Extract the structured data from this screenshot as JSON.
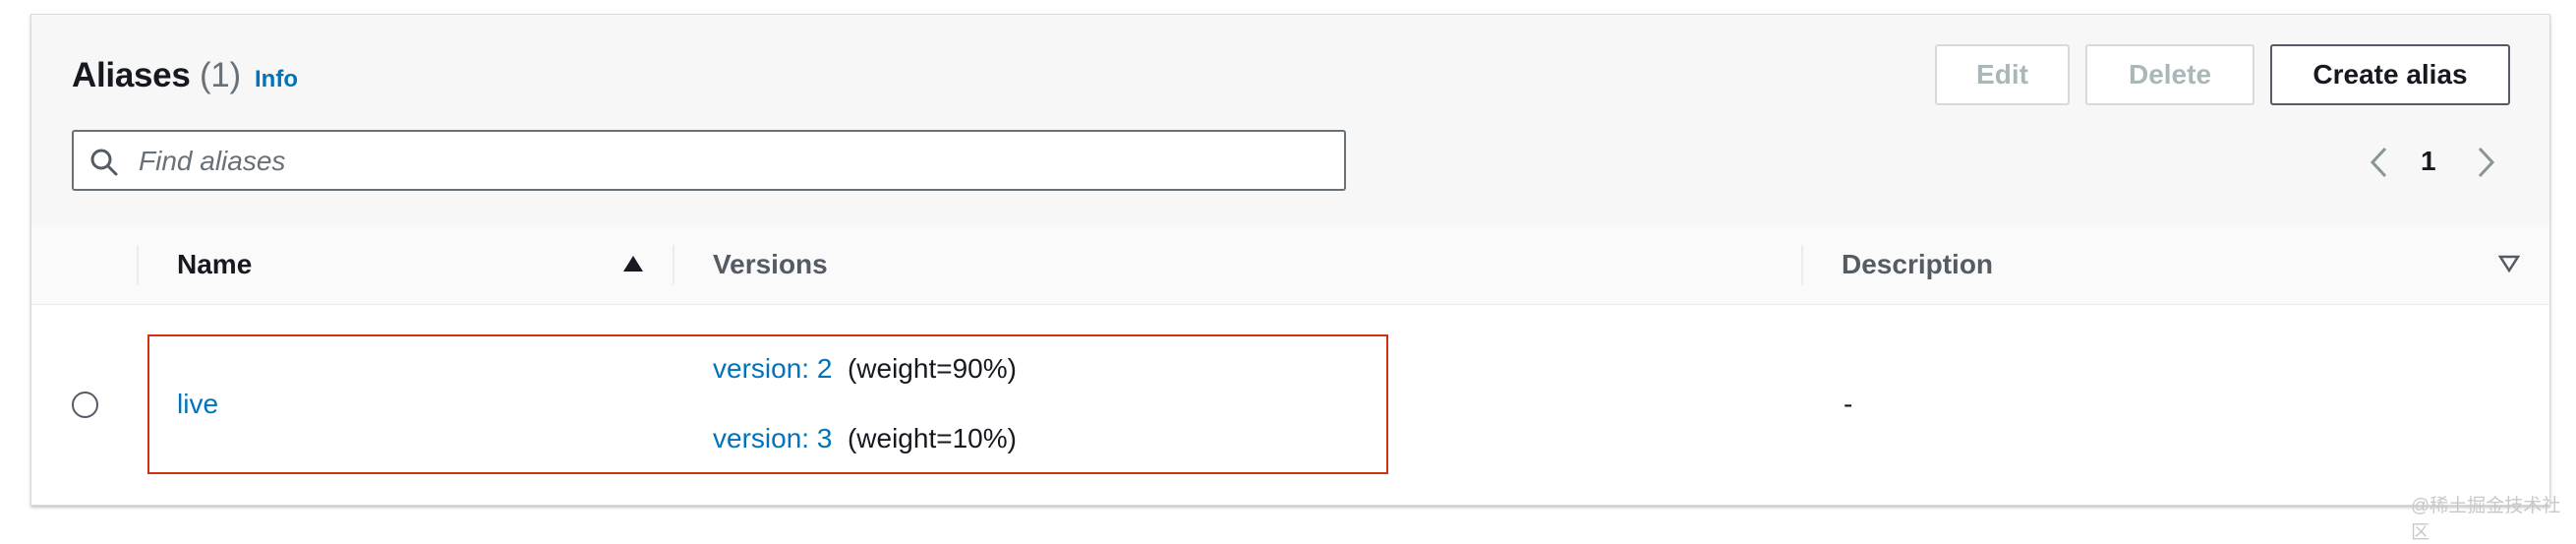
{
  "header": {
    "title": "Aliases",
    "count": "(1)",
    "info_link": "Info"
  },
  "actions": {
    "edit_label": "Edit",
    "delete_label": "Delete",
    "create_label": "Create alias"
  },
  "search": {
    "placeholder": "Find aliases",
    "value": ""
  },
  "pagination": {
    "current_page": "1"
  },
  "table": {
    "columns": [
      {
        "label": "Name",
        "sort": "ascending"
      },
      {
        "label": "Versions"
      },
      {
        "label": "Description",
        "sort": "descending"
      }
    ],
    "rows": [
      {
        "selected": false,
        "name": "live",
        "versions": [
          {
            "version_label": "version: 2",
            "weight": "(weight=90%)"
          },
          {
            "version_label": "version: 3",
            "weight": "(weight=10%)"
          }
        ],
        "description": "-"
      }
    ]
  },
  "watermark": "@稀土掘金技术社区",
  "colors": {
    "link": "#0073bb",
    "highlight_border": "#d13212",
    "disabled_text": "#aab7b8",
    "header_bg": "#f7f7f7"
  }
}
